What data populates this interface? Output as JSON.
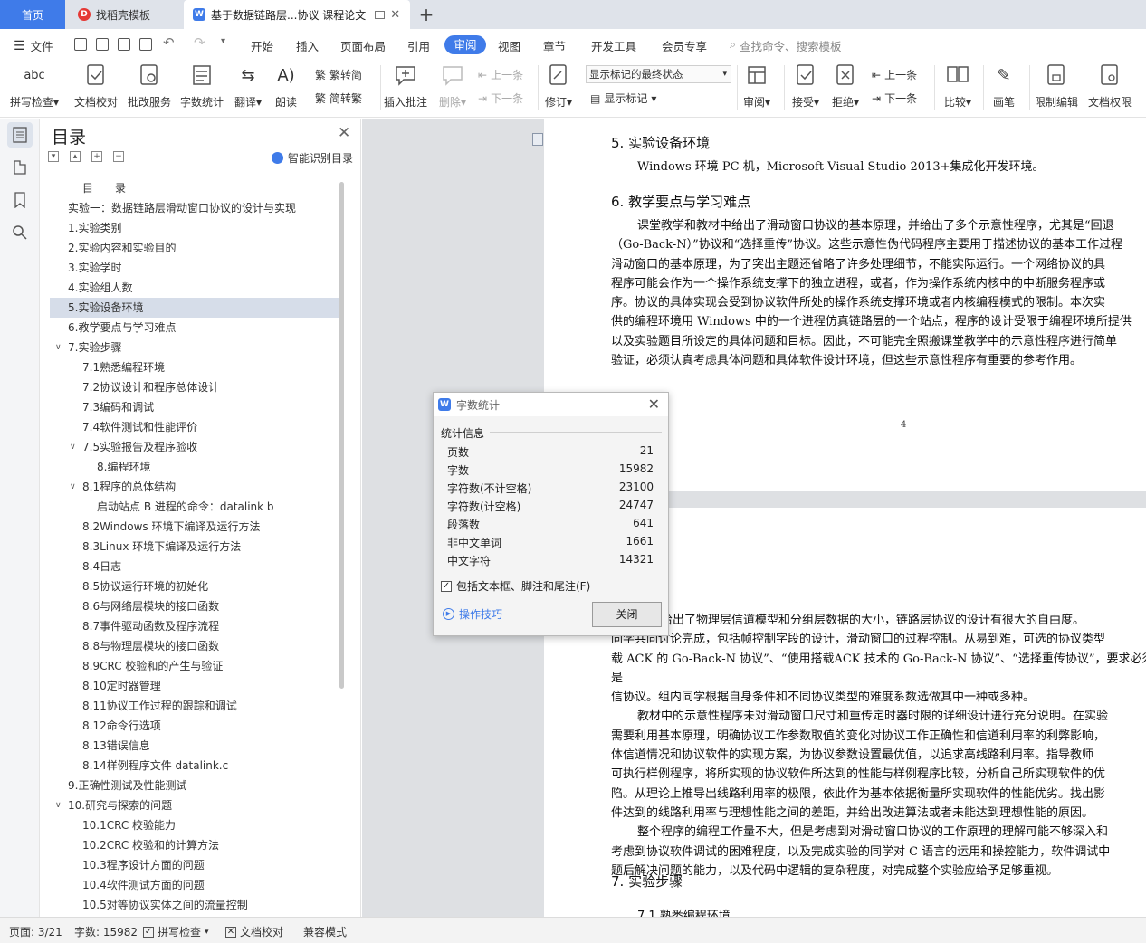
{
  "tabs": {
    "home": "首页",
    "template": "找稻壳模板",
    "doc": "基于数据链路层...协议 课程论文"
  },
  "menu": {
    "file": "文件",
    "items": [
      "开始",
      "插入",
      "页面布局",
      "引用",
      "审阅",
      "视图",
      "章节",
      "开发工具",
      "会员专享"
    ],
    "active": "审阅",
    "search": "查找命令、搜索模板"
  },
  "ribbon": {
    "spell_check": "拼写检查",
    "doc_proof": "文档校对",
    "batch_service": "批改服务",
    "word_count": "字数统计",
    "translate": "翻译",
    "read_aloud": "朗读",
    "trad_to_simp": "繁转简",
    "simp_to_trad": "简转繁",
    "insert_comment": "插入批注",
    "delete": "删除",
    "prev": "上一条",
    "next": "下一条",
    "track": "修订",
    "markup_state": "显示标记的最终状态",
    "show_markup": "显示标记",
    "review": "审阅",
    "accept": "接受",
    "reject": "拒绝",
    "prev2": "上一条",
    "next2": "下一条",
    "compare": "比较",
    "pen": "画笔",
    "restrict_edit": "限制编辑",
    "doc_permission": "文档权限"
  },
  "toc": {
    "title": "目录",
    "smart": "智能识别目录",
    "items": [
      {
        "text": "目　　录",
        "indent": 1,
        "caret": ""
      },
      {
        "text": "实验一：数据链路层滑动窗口协议的设计与实现",
        "indent": 0,
        "caret": ""
      },
      {
        "text": "1.实验类别",
        "indent": 0,
        "caret": ""
      },
      {
        "text": "2.实验内容和实验目的",
        "indent": 0,
        "caret": ""
      },
      {
        "text": "3.实验学时",
        "indent": 0,
        "caret": ""
      },
      {
        "text": "4.实验组人数",
        "indent": 0,
        "caret": ""
      },
      {
        "text": "5.实验设备环境",
        "indent": 0,
        "caret": "",
        "selected": true
      },
      {
        "text": "6.教学要点与学习难点",
        "indent": 0,
        "caret": ""
      },
      {
        "text": "7.实验步骤",
        "indent": 0,
        "caret": "down"
      },
      {
        "text": "7.1熟悉编程环境",
        "indent": 1,
        "caret": ""
      },
      {
        "text": "7.2协议设计和程序总体设计",
        "indent": 1,
        "caret": ""
      },
      {
        "text": "7.3编码和调试",
        "indent": 1,
        "caret": ""
      },
      {
        "text": "7.4软件测试和性能评价",
        "indent": 1,
        "caret": ""
      },
      {
        "text": "7.5实验报告及程序验收",
        "indent": 1,
        "caret": "down"
      },
      {
        "text": "8.编程环境",
        "indent": 2,
        "caret": ""
      },
      {
        "text": "8.1程序的总体结构",
        "indent": 1,
        "caret": "down"
      },
      {
        "text": "启动站点 B 进程的命令：datalink  b",
        "indent": 2,
        "caret": ""
      },
      {
        "text": "8.2Windows 环境下编译及运行方法",
        "indent": 1,
        "caret": ""
      },
      {
        "text": "8.3Linux 环境下编译及运行方法",
        "indent": 1,
        "caret": ""
      },
      {
        "text": "8.4日志",
        "indent": 1,
        "caret": ""
      },
      {
        "text": "8.5协议运行环境的初始化",
        "indent": 1,
        "caret": ""
      },
      {
        "text": "8.6与网络层模块的接口函数",
        "indent": 1,
        "caret": ""
      },
      {
        "text": "8.7事件驱动函数及程序流程",
        "indent": 1,
        "caret": ""
      },
      {
        "text": "8.8与物理层模块的接口函数",
        "indent": 1,
        "caret": ""
      },
      {
        "text": "8.9CRC 校验和的产生与验证",
        "indent": 1,
        "caret": ""
      },
      {
        "text": "8.10定时器管理",
        "indent": 1,
        "caret": ""
      },
      {
        "text": "8.11协议工作过程的跟踪和调试",
        "indent": 1,
        "caret": ""
      },
      {
        "text": "8.12命令行选项",
        "indent": 1,
        "caret": ""
      },
      {
        "text": "8.13错误信息",
        "indent": 1,
        "caret": ""
      },
      {
        "text": "8.14样例程序文件 datalink.c",
        "indent": 1,
        "caret": ""
      },
      {
        "text": "9.正确性测试及性能测试",
        "indent": 0,
        "caret": ""
      },
      {
        "text": "10.研究与探索的问题",
        "indent": 0,
        "caret": "down"
      },
      {
        "text": "10.1CRC 校验能力",
        "indent": 1,
        "caret": ""
      },
      {
        "text": "10.2CRC 校验和的计算方法",
        "indent": 1,
        "caret": ""
      },
      {
        "text": "10.3程序设计方面的问题",
        "indent": 1,
        "caret": ""
      },
      {
        "text": "10.4软件测试方面的问题",
        "indent": 1,
        "caret": ""
      },
      {
        "text": "10.5对等协议实体之间的流量控制",
        "indent": 1,
        "caret": ""
      }
    ]
  },
  "doc": {
    "h5": "5. 实验设备环境",
    "p5": "Windows 环境 PC 机，Microsoft Visual Studio 2013+集成化开发环境。",
    "h6": "6. 教学要点与学习难点",
    "p6": [
      "课堂教学和教材中给出了滑动窗口协议的基本原理，并给出了多个示意性程序，尤其是“回退",
      "（Go-Back-N）”协议和“选择重传”协议。这些示意性伪代码程序主要用于描述协议的基本工作过程",
      "滑动窗口的基本原理，为了突出主题还省略了许多处理细节，不能实际运行。一个网络协议的具",
      "程序可能会作为一个操作系统支撑下的独立进程，或者，作为操作系统内核中的中断服务程序或",
      "序。协议的具体实现会受到协议软件所处的操作系统支撑环境或者内核编程模式的限制。本次实",
      "供的编程环境用 Windows 中的一个进程仿真链路层的一个站点，程序的设计受限于编程环境所提供",
      "以及实验题目所设定的具体问题和目标。因此，不可能完全照搬课堂教学中的示意性程序进行简单",
      "验证，必须认真考虑具体问题和具体软件设计环境，但这些示意性程序有重要的参考作用。"
    ],
    "page_num": "4",
    "p7": [
      "题目给出了物理层信道模型和分组层数据的大小，链路层协议的设计有很大的自由度。",
      "同学共同讨论完成，包括帧控制字段的设计，滑动窗口的过程控制。从易到难，可选的协议类型",
      "载 ACK 的 Go-Back-N 协议”、“使用搭载ACK 技术的 Go-Back-N 协议”、“选择重传协议”，要求必须是",
      "信协议。组内同学根据自身条件和不同协议类型的难度系数选做其中一种或多种。",
      "教材中的示意性程序未对滑动窗口尺寸和重传定时器时限的详细设计进行充分说明。在实验",
      "需要利用基本原理，明确协议工作参数取值的变化对协议工作正确性和信道利用率的利弊影响，",
      "体信道情况和协议软件的实现方案，为协议参数设置最优值，以追求高线路利用率。指导教师",
      "可执行样例程序，将所实现的协议软件所达到的性能与样例程序比较，分析自己所实现软件的优",
      "陷。从理论上推导出线路利用率的极限，依此作为基本依据衡量所实现软件的性能优劣。找出影",
      "件达到的线路利用率与理想性能之间的差距，并给出改进算法或者未能达到理想性能的原因。",
      "整个程序的编程工作量不大，但是考虑到对滑动窗口协议的工作原理的理解可能不够深入和",
      "考虑到协议软件调试的困难程度，以及完成实验的同学对 C 语言的运用和操控能力，软件调试中",
      "题后解决问题的能力，以及代码中逻辑的复杂程度，对完成整个实验应给予足够重视。"
    ],
    "h7": "7. 实验步骤",
    "h71": "7.1 熟悉编程环境"
  },
  "dialog": {
    "title": "字数统计",
    "group": "统计信息",
    "stats": [
      {
        "label": "页数",
        "value": "21"
      },
      {
        "label": "字数",
        "value": "15982"
      },
      {
        "label": "字符数(不计空格)",
        "value": "23100"
      },
      {
        "label": "字符数(计空格)",
        "value": "24747"
      },
      {
        "label": "段落数",
        "value": "641"
      },
      {
        "label": "非中文单词",
        "value": "1661"
      },
      {
        "label": "中文字符",
        "value": "14321"
      }
    ],
    "include": "包括文本框、脚注和尾注(F)",
    "tips": "操作技巧",
    "close": "关闭"
  },
  "status": {
    "page": "页面: 3/21",
    "words": "字数: 15982",
    "spell": "拼写检查",
    "proof": "文档校对",
    "compat": "兼容模式"
  },
  "colors": {
    "accent": "#3f7be9",
    "wps_red": "#e53935"
  }
}
